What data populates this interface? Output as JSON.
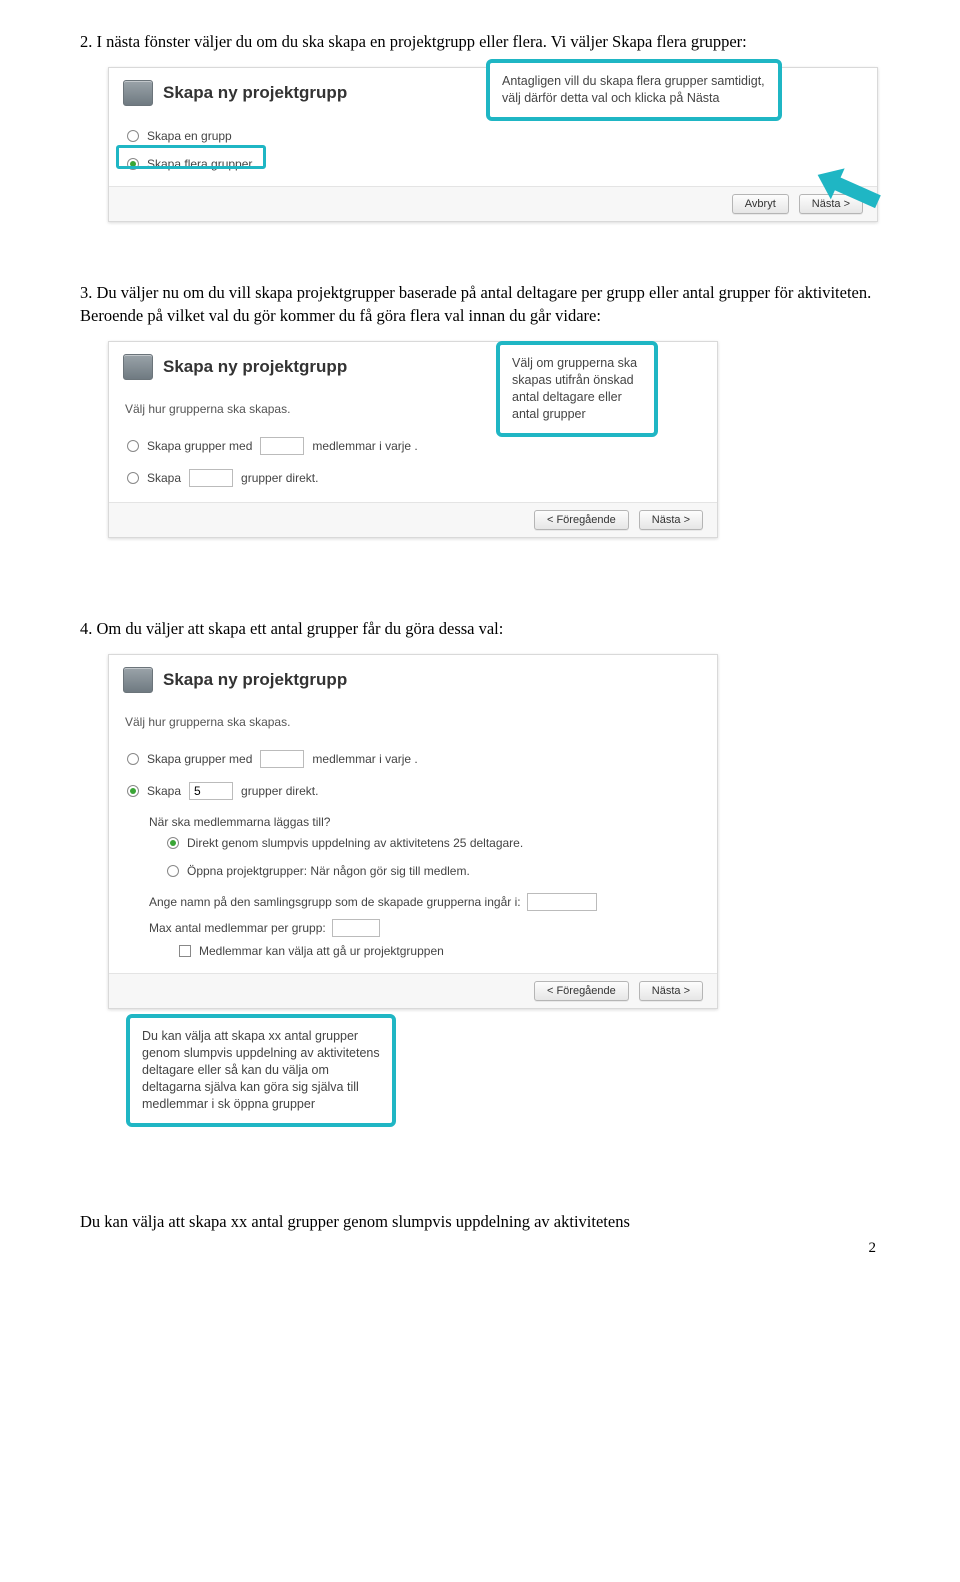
{
  "para1_num": "2.",
  "para1_text": "I nästa fönster väljer du om du ska skapa en projektgrupp eller flera. Vi väljer Skapa flera grupper:",
  "para2_num": "3.",
  "para2_text": "Du väljer nu om du vill skapa projektgrupper baserade på antal deltagare per grupp eller antal grupper för aktiviteten. Beroende på vilket val du gör kommer du få göra flera val innan du går vidare:",
  "para3_num": "4.",
  "para3_text": "Om du väljer att skapa ett antal grupper får du göra dessa val:",
  "para4_text": "Du kan välja att skapa xx antal grupper genom slumpvis uppdelning av aktivitetens",
  "panel_title": "Skapa ny projektgrupp",
  "s1": {
    "opt_single": "Skapa en grupp",
    "opt_multi": "Skapa flera grupper",
    "btn_cancel": "Avbryt",
    "btn_next": "Nästa >",
    "callout": "Antagligen vill du skapa flera grupper samtidigt, välj därför detta val och klicka på Nästa"
  },
  "s2": {
    "help": "Välj hur grupperna ska skapas.",
    "row1_a": "Skapa grupper med",
    "row1_b": "medlemmar i varje .",
    "row2_a": "Skapa",
    "row2_b": "grupper direkt.",
    "btn_prev": "< Föregående",
    "btn_next": "Nästa >",
    "callout": "Välj om grupperna ska skapas utifrån önskad antal deltagare eller antal grupper"
  },
  "s3": {
    "help": "Välj hur grupperna ska skapas.",
    "row1_a": "Skapa grupper med",
    "row1_b": "medlemmar i varje .",
    "row2_a": "Skapa",
    "row2_val": "5",
    "row2_b": "grupper direkt.",
    "q_when": "När ska medlemmarna läggas till?",
    "opt_direct": "Direkt genom slumpvis uppdelning av aktivitetens 25 deltagare.",
    "opt_open": "Öppna projektgrupper: När någon gör sig till medlem.",
    "lbl_name": "Ange namn på den samlingsgrupp som de skapade grupperna ingår i:",
    "lbl_max": "Max antal medlemmar per grupp:",
    "chk_leave": "Medlemmar kan välja att gå ur projektgruppen",
    "btn_prev": "< Föregående",
    "btn_next": "Nästa >",
    "callout": "Du kan välja att skapa xx antal grupper genom slumpvis uppdelning av aktivitetens deltagare eller så kan du välja om deltagarna själva kan göra sig själva till medlemmar i sk öppna grupper"
  },
  "page_number": "2"
}
